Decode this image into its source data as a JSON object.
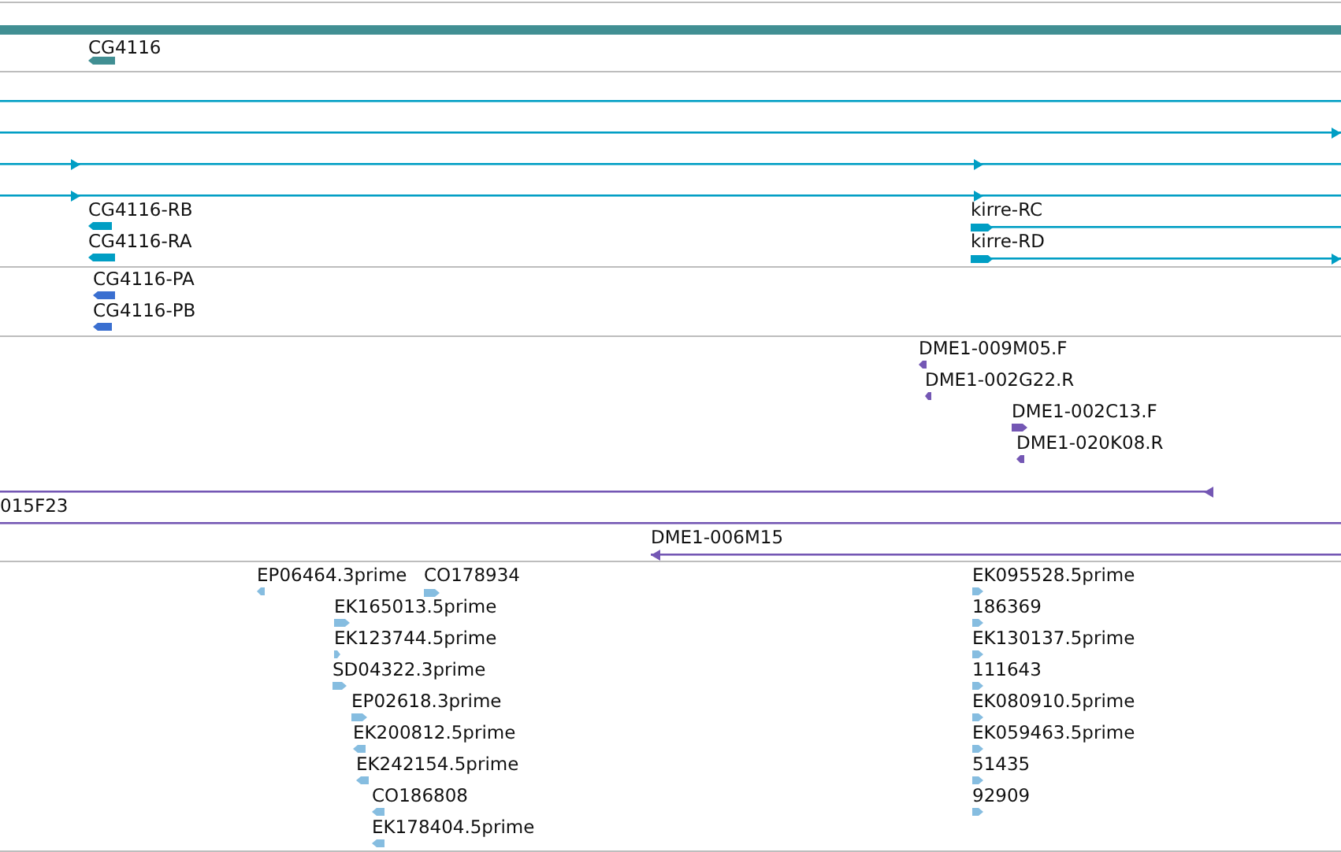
{
  "tracks": [
    {
      "color": "#418f93",
      "features": [
        {
          "kind": "summary"
        },
        {
          "kind": "gene",
          "label": "CG4116",
          "reverse": true
        }
      ]
    },
    {
      "color": "#009ec4",
      "features": [
        {
          "kind": "line"
        },
        {
          "kind": "line",
          "reverse": false
        },
        {
          "kind": "line",
          "reverse": false
        },
        {
          "kind": "line",
          "reverse": false
        },
        {
          "kind": "gene",
          "label": "CG4116-RB",
          "reverse": true
        },
        {
          "kind": "transcript",
          "label": "kirre-RC",
          "reverse": false
        },
        {
          "kind": "gene",
          "label": "CG4116-RA",
          "reverse": true
        },
        {
          "kind": "transcript",
          "label": "kirre-RD",
          "reverse": false
        }
      ]
    },
    {
      "color": "#3a6fd0",
      "features": [
        {
          "kind": "gene",
          "label": "CG4116-PA",
          "reverse": true
        },
        {
          "kind": "gene",
          "label": "CG4116-PB",
          "reverse": true
        }
      ]
    },
    {
      "color": "#7457b4",
      "features": [
        {
          "kind": "gene",
          "label": "DME1-009M05.F",
          "reverse": true
        },
        {
          "kind": "gene",
          "label": "DME1-002G22.R",
          "reverse": true
        },
        {
          "kind": "gene",
          "label": "DME1-002C13.F",
          "reverse": false
        },
        {
          "kind": "gene",
          "label": "DME1-020K08.R",
          "reverse": true
        },
        {
          "kind": "line",
          "reverse": true
        },
        {
          "kind": "line",
          "label": "015F23"
        },
        {
          "kind": "line",
          "label": "DME1-006M15",
          "reverse": true
        }
      ]
    },
    {
      "color": "#86bde0",
      "features": [
        {
          "kind": "gene",
          "label": "EP06464.3prime",
          "reverse": true
        },
        {
          "kind": "gene",
          "label": "CO178934",
          "reverse": false
        },
        {
          "kind": "gene",
          "label": "EK165013.5prime",
          "reverse": false
        },
        {
          "kind": "gene",
          "label": "EK123744.5prime",
          "reverse": false
        },
        {
          "kind": "gene",
          "label": "SD04322.3prime",
          "reverse": false
        },
        {
          "kind": "gene",
          "label": "EP02618.3prime",
          "reverse": false
        },
        {
          "kind": "gene",
          "label": "EK200812.5prime",
          "reverse": true
        },
        {
          "kind": "gene",
          "label": "EK242154.5prime",
          "reverse": true
        },
        {
          "kind": "gene",
          "label": "CO186808",
          "reverse": true
        },
        {
          "kind": "gene",
          "label": "EK178404.5prime",
          "reverse": true
        },
        {
          "kind": "gene",
          "label": "EK095528.5prime",
          "reverse": false
        },
        {
          "kind": "gene",
          "label": "186369",
          "reverse": false
        },
        {
          "kind": "gene",
          "label": "EK130137.5prime",
          "reverse": false
        },
        {
          "kind": "gene",
          "label": "111643",
          "reverse": false
        },
        {
          "kind": "gene",
          "label": "EK080910.5prime",
          "reverse": false
        },
        {
          "kind": "gene",
          "label": "EK059463.5prime",
          "reverse": false
        },
        {
          "kind": "gene",
          "label": "51435",
          "reverse": false
        },
        {
          "kind": "gene",
          "label": "92909",
          "reverse": false
        }
      ]
    }
  ]
}
